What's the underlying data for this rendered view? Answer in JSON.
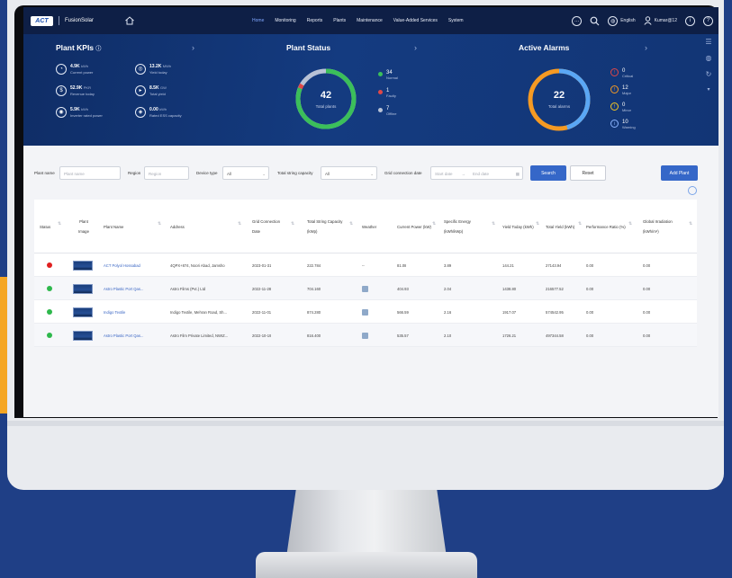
{
  "nav": {
    "logo": "ACT",
    "brand": "FusionSolar",
    "menu": [
      "Home",
      "Monitoring",
      "Reports",
      "Plants",
      "Maintenance",
      "Value-Added Services",
      "System"
    ],
    "active_index": 0,
    "language": "English",
    "user": "Kumar@12"
  },
  "kpis": {
    "title": "Plant KPIs",
    "items": [
      {
        "value": "4.9K",
        "unit": "kWh",
        "label": "Current power"
      },
      {
        "value": "13.2K",
        "unit": "MWh",
        "label": "Yield today"
      },
      {
        "value": "52.9K",
        "unit": "PKR",
        "label": "Revenue today"
      },
      {
        "value": "8.5K",
        "unit": "GW",
        "label": "Total yield"
      },
      {
        "value": "5.9K",
        "unit": "kWh",
        "label": "Inverter rated power"
      },
      {
        "value": "0.00",
        "unit": "kWh",
        "label": "Rated ESS capacity"
      }
    ]
  },
  "plant_status": {
    "title": "Plant Status",
    "total": "42",
    "total_label": "Total plants",
    "legend": [
      {
        "count": "34",
        "label": "Normal",
        "color": "#3bbf5a"
      },
      {
        "count": "1",
        "label": "Faulty",
        "color": "#e04848"
      },
      {
        "count": "7",
        "label": "Offline",
        "color": "#b8c2d6"
      }
    ]
  },
  "alarms": {
    "title": "Active Alarms",
    "total": "22",
    "total_label": "Total alarms",
    "items": [
      {
        "count": "0",
        "label": "Critical",
        "color": "#e04848",
        "icon": "!"
      },
      {
        "count": "12",
        "label": "Major",
        "color": "#f59a23",
        "icon": "!"
      },
      {
        "count": "0",
        "label": "Minor",
        "color": "#f5c623",
        "icon": "!"
      },
      {
        "count": "10",
        "label": "Warning",
        "color": "#8bb4ff",
        "icon": "i"
      }
    ]
  },
  "filter": {
    "plant_name_label": "Plant name",
    "plant_name_ph": "Plant name",
    "region_label": "Region",
    "region_ph": "Region",
    "device_type_label": "Device type",
    "device_type_value": "All",
    "capacity_label": "Total string capacity",
    "capacity_value": "All",
    "date_label": "Grid connection date",
    "start_ph": "Start date",
    "end_ph": "End date",
    "search_label": "Search",
    "reset_label": "Reset",
    "add_label": "Add Plant"
  },
  "table": {
    "headers": [
      "Status",
      "Plant Image",
      "Plant Name",
      "Address",
      "Grid Connection Date",
      "Total String Capacity (kWp)",
      "Weather",
      "Current Power (kW)",
      "Specific Energy (kWh/kWp)",
      "Yield Today (kWh)",
      "Total Yield (kWh)",
      "Performance Ratio (%)",
      "Global Irradiation (kWh/m²)"
    ],
    "rows": [
      {
        "status": "#e02020",
        "name": "ACT Polyol Hossabad",
        "address": "4QPX+874, Noori Abad, Jamsho",
        "date": "2023-01-31",
        "capacity": "222.784",
        "weather": "--",
        "power": "81.08",
        "specific": "3.89",
        "yield_today": "144.21",
        "total_yield": "27143.94",
        "pr": "0.00",
        "irr": "0.00"
      },
      {
        "status": "#2eb84c",
        "name": "Astro Plastic Port Qas...",
        "address": "Astro Films (Pvt.) Ltd",
        "date": "2022-11-28",
        "capacity": "704.160",
        "weather": "icon",
        "power": "404.93",
        "specific": "2.04",
        "yield_today": "1438.80",
        "total_yield": "216577.52",
        "pr": "0.00",
        "irr": "0.00"
      },
      {
        "status": "#2eb84c",
        "name": "Indigo Textile",
        "address": "Indigo Textile, Mehran Road, Sh...",
        "date": "2022-11-01",
        "capacity": "874.280",
        "weather": "icon",
        "power": "566.59",
        "specific": "2.16",
        "yield_today": "1917.07",
        "total_yield": "574542.95",
        "pr": "0.00",
        "irr": "0.00"
      },
      {
        "status": "#2eb84c",
        "name": "Astro Plastic Port Qas...",
        "address": "Astro Film Private Limited, NWIZ...",
        "date": "2022-10-19",
        "capacity": "816.400",
        "weather": "icon",
        "power": "535.57",
        "specific": "2.10",
        "yield_today": "1726.21",
        "total_yield": "497344.58",
        "pr": "0.00",
        "irr": "0.00"
      }
    ]
  }
}
